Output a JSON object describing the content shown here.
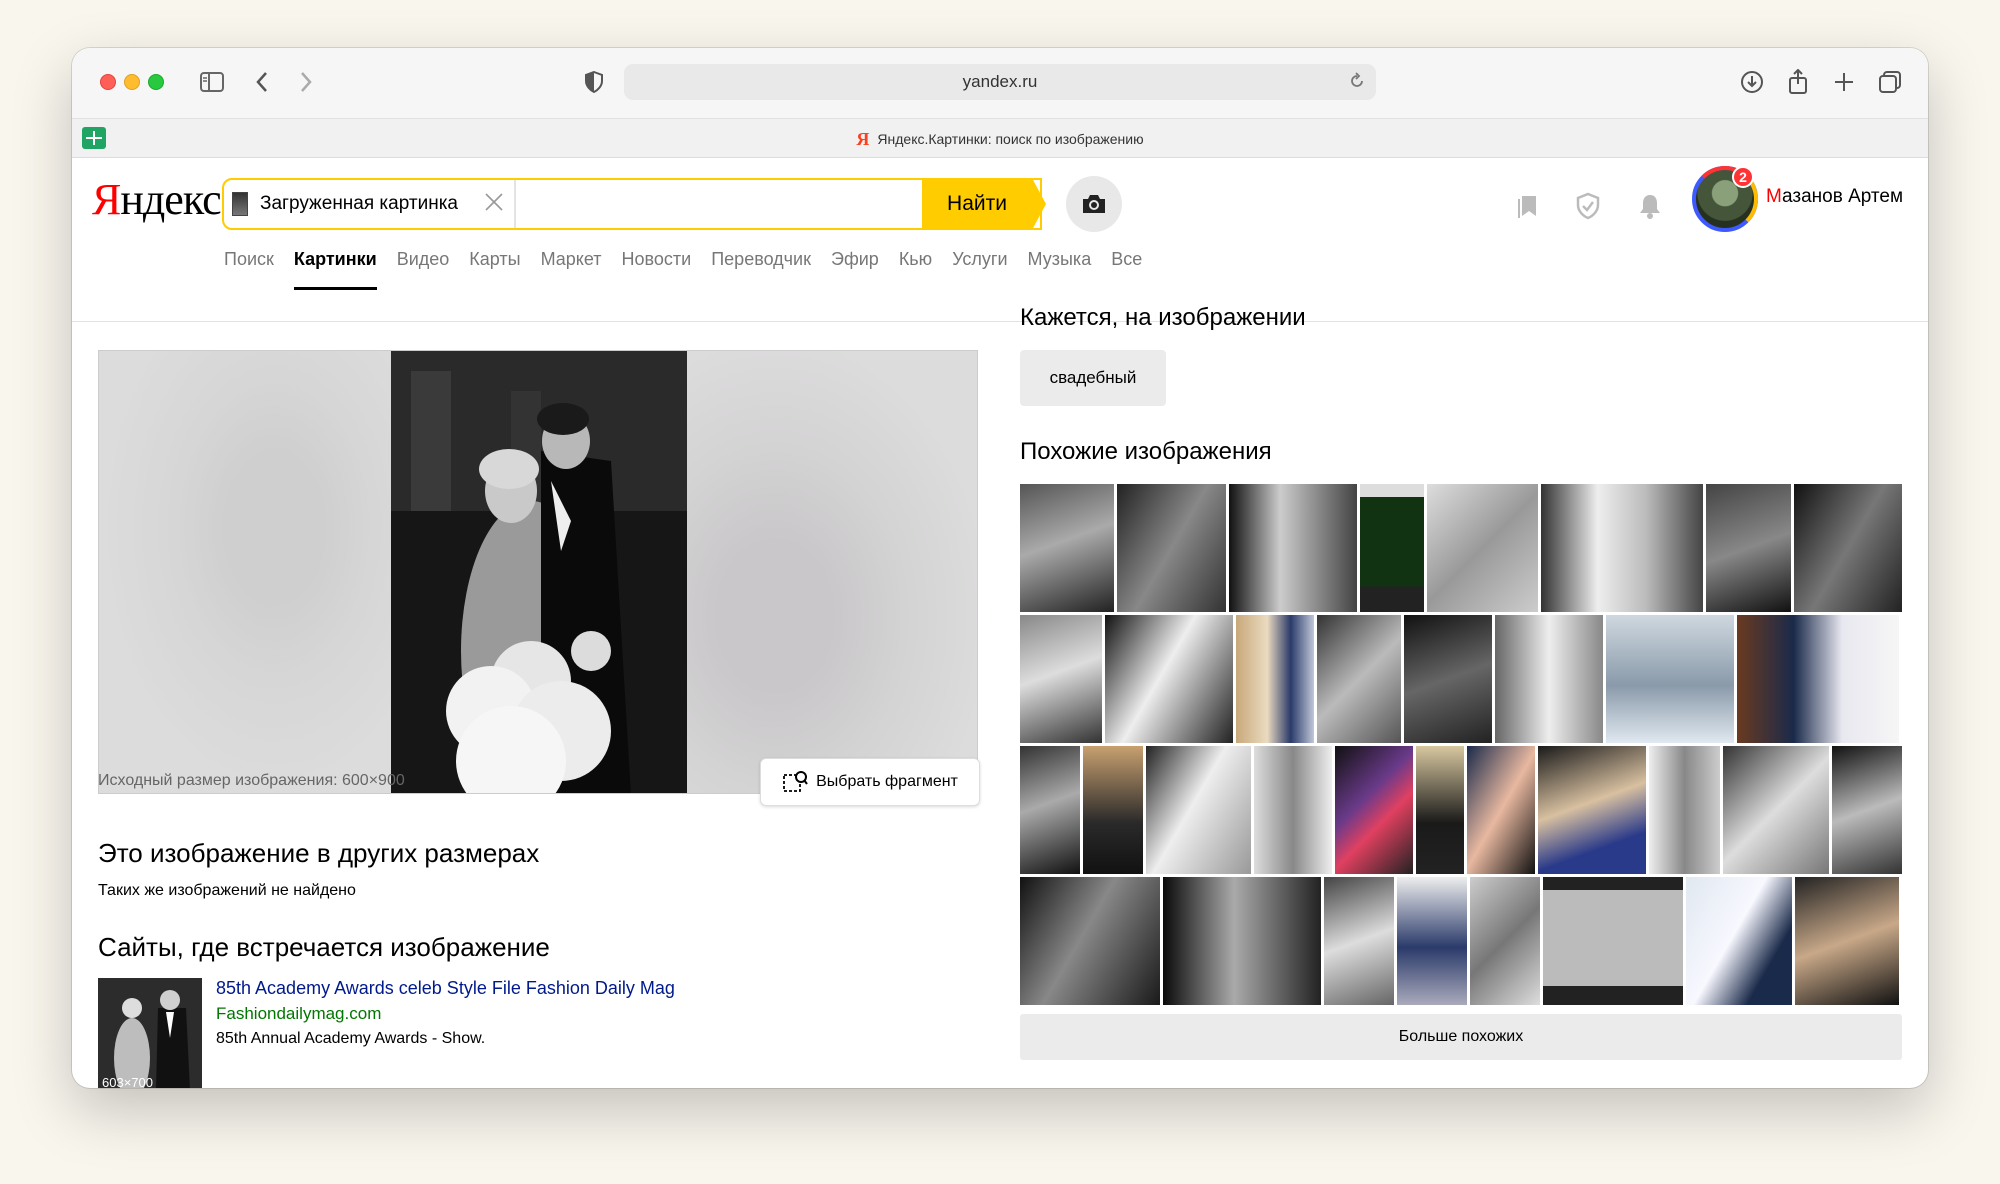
{
  "browser": {
    "url": "yandex.ru",
    "tab_title": "Яндекс.Картинки: поиск по изображению",
    "tab_favicon": "Я"
  },
  "header": {
    "logo_first": "Я",
    "logo_rest": "ндекс",
    "search_chip_label": "Загруженная картинка",
    "search_button": "Найти",
    "user_name_first": "М",
    "user_name_rest": "азанов Артем",
    "notifications_count": "2",
    "services": [
      {
        "label": "Поиск",
        "active": false
      },
      {
        "label": "Картинки",
        "active": true
      },
      {
        "label": "Видео",
        "active": false
      },
      {
        "label": "Карты",
        "active": false
      },
      {
        "label": "Маркет",
        "active": false
      },
      {
        "label": "Новости",
        "active": false
      },
      {
        "label": "Переводчик",
        "active": false
      },
      {
        "label": "Эфир",
        "active": false
      },
      {
        "label": "Кью",
        "active": false
      },
      {
        "label": "Услуги",
        "active": false
      },
      {
        "label": "Музыка",
        "active": false
      },
      {
        "label": "Все",
        "active": false
      }
    ]
  },
  "left": {
    "original_size": "Исходный размер изображения: 600×900",
    "fragment_button": "Выбрать фрагмент",
    "other_sizes_heading": "Это изображение в других размерах",
    "other_sizes_note": "Таких же изображений не найдено",
    "sites_heading": "Сайты, где встречается изображение",
    "sites": [
      {
        "title": "85th Academy Awards celeb Style File Fashion Daily Mag",
        "url": "Fashiondailymag.com",
        "description": "85th Annual Academy Awards - Show.",
        "thumb_size": "603×700"
      }
    ]
  },
  "right": {
    "seems_heading": "Кажется, на изображении",
    "tag": "свадебный",
    "similar_heading": "Похожие изображения",
    "more_button": "Больше похожих"
  },
  "colors": {
    "yandex_red": "#ff0000",
    "search_yellow": "#ffcc00",
    "link_blue": "#001a8c",
    "url_green": "#007700"
  }
}
